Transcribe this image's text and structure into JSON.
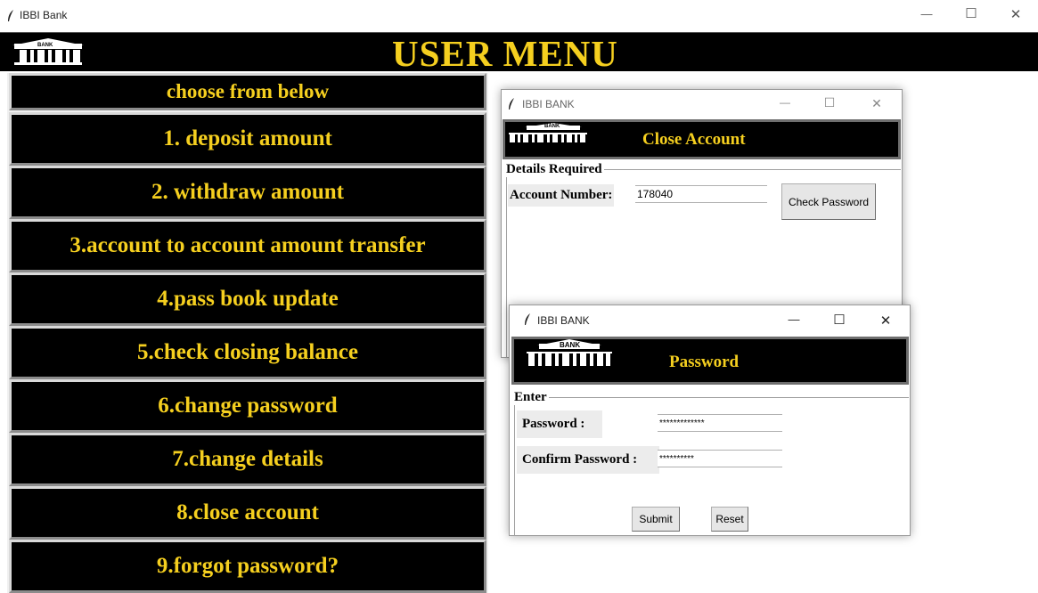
{
  "main_window": {
    "title": "IBBI Bank",
    "controls": {
      "minimize": "—",
      "maximize": "☐",
      "close": "✕"
    }
  },
  "header": {
    "title": "USER MENU",
    "logo_text": "BANK"
  },
  "menu": {
    "heading": "choose from below",
    "items": [
      "1. deposit amount",
      "2. withdraw amount",
      "3.account to account amount transfer",
      "4.pass book update",
      "5.check closing balance",
      "6.change password",
      "7.change details",
      "8.close account",
      "9.forgot password?"
    ]
  },
  "close_account_dialog": {
    "title": "IBBI BANK",
    "header": "Close Account",
    "logo_text": "BANK",
    "group_label": "Details Required",
    "account_label": "Account Number:",
    "account_value": "178040",
    "check_button": "Check Password",
    "controls": {
      "minimize": "—",
      "maximize": "☐",
      "close": "✕"
    }
  },
  "password_dialog": {
    "title": "IBBI BANK",
    "header": "Password",
    "logo_text": "BANK",
    "group_label": "Enter",
    "password_label": "Password :",
    "password_value": "*************",
    "confirm_label": "Confirm Password :",
    "confirm_value": "**********",
    "submit_button": "Submit",
    "reset_button": "Reset",
    "controls": {
      "minimize": "—",
      "maximize": "☐",
      "close": "✕"
    }
  },
  "colors": {
    "accent_text": "#f5cf1f",
    "header_bg": "#000000",
    "menu_border": "#8c8c8c"
  }
}
